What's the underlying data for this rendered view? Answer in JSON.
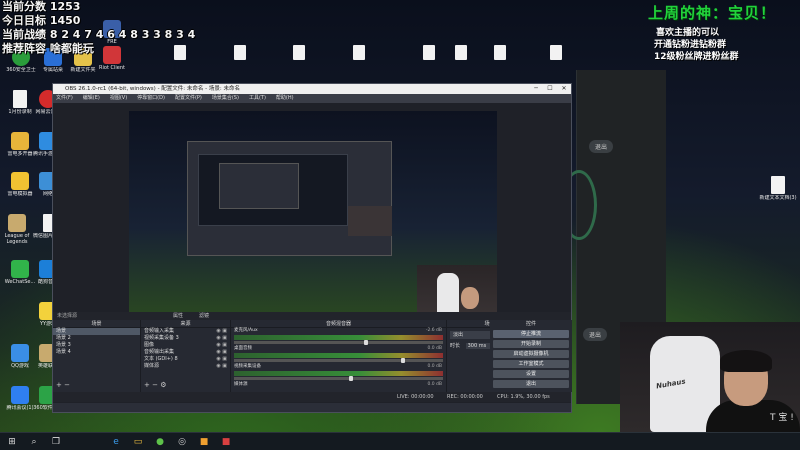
{
  "overlay": {
    "score_line": "当前分数 1253",
    "target_line": "今日目标 1450",
    "record_line": "当前战绩 8 2 4 7 4 6 4 8 3 3 8 3 4",
    "recommend_line": "推荐阵容 啥都能玩"
  },
  "right_overlay": {
    "title": "上周的神：宝贝！",
    "line1": "喜欢主播的可以",
    "line2": "开通钻粉进钻粉群",
    "line3": "12级粉丝牌进粉丝群"
  },
  "desktop_icons": [
    {
      "label": "360安全卫士",
      "color": "#2a9d3b"
    },
    {
      "label": "专属站桌",
      "color": "#2a6fd6"
    },
    {
      "label": "新建文件夹",
      "color": "#e4c24a"
    },
    {
      "label": "FRE",
      "color": "#3a5fa8"
    },
    {
      "label": "Riot Client",
      "color": "#d13639"
    },
    {
      "label": "1月份录制",
      "color": "#f0f0f0"
    },
    {
      "label": "网易云音乐",
      "color": "#d42b2b"
    },
    {
      "label": "雷电多开器",
      "color": "#e7b43a"
    },
    {
      "label": "腾讯手游助手",
      "color": "#2f8ce0"
    },
    {
      "label": "雷电模拟器",
      "color": "#f1c232"
    },
    {
      "label": "网络",
      "color": "#3d8fd6"
    },
    {
      "label": "League of Legends",
      "color": "#c8aa6e"
    },
    {
      "label": "微信图片_2022053...",
      "color": "#f0f0f0"
    },
    {
      "label": "WeChatSe...",
      "color": "#31b34a"
    },
    {
      "label": "酷狗音乐",
      "color": "#1c7fd8"
    },
    {
      "label": "YY游戏",
      "color": "#f3d23c"
    },
    {
      "label": "QQ游戏",
      "color": "#3a8ee6"
    },
    {
      "label": "英雄联盟",
      "color": "#c8aa6e"
    },
    {
      "label": "腾讯会议(1)",
      "color": "#2f7ff0"
    },
    {
      "label": "360软件管家",
      "color": "#2ca347"
    }
  ],
  "right_doc_icon": {
    "label": "新建文本文档(3)"
  },
  "obs": {
    "title": "OBS 26.1.0-rc1 (64-bit, windows) - 配置文件: 未命名 - 场景: 未命名",
    "menu": [
      "文件(F)",
      "编辑(E)",
      "视图(V)",
      "停靠窗口(D)",
      "配置文件(P)",
      "场景集合(S)",
      "工具(T)",
      "帮助(H)"
    ],
    "window_controls": [
      "─",
      "☐",
      "✕"
    ],
    "no_source": "未选择源",
    "tabs": [
      "属性",
      "滤镜"
    ],
    "docks": {
      "scenes": "场景",
      "sources": "来源",
      "mixer": "音频混音器",
      "transitions": "场景过渡",
      "controls": "控件"
    },
    "scenes": [
      "场景",
      "场景 2",
      "场景 3",
      "场景 4"
    ],
    "sources": [
      "音频输入采集",
      "视频采集设备 3",
      "图像",
      "音频输出采集",
      "文本 (GDI+) 8",
      "媒体源"
    ],
    "mixer": [
      {
        "name": "麦克风/Aux",
        "db": "-2.6 dB",
        "level": 0.62
      },
      {
        "name": "桌面音频",
        "db": "0.0 dB",
        "level": 0.8
      },
      {
        "name": "视频采集设备",
        "db": "0.0 dB",
        "level": 0.55
      },
      {
        "name": "媒体源",
        "db": "0.0 dB",
        "level": 0.5
      }
    ],
    "transition": {
      "type": "淡出",
      "duration_label": "时长",
      "duration": "300 ms"
    },
    "controls": [
      "停止推流",
      "开始录制",
      "启动虚拟摄像机",
      "工作室模式",
      "设置",
      "退出"
    ],
    "status": {
      "live": "LIVE: 00:00:00",
      "rec": "REC: 00:00:00",
      "cpu": "CPU: 1.9%, 30.00 fps"
    }
  },
  "bgapp": {
    "exit_label": "退出",
    "settings_label": "退出"
  },
  "webcam": {
    "chair_brand": "Nuhaus",
    "shirt_text": "T 宝 !"
  },
  "taskbar": {
    "items": [
      {
        "name": "start",
        "glyph": "⊞"
      },
      {
        "name": "search",
        "glyph": "⌕"
      },
      {
        "name": "task-view",
        "glyph": "❐"
      },
      {
        "name": "edge",
        "glyph": "e"
      },
      {
        "name": "folder",
        "glyph": "▭"
      },
      {
        "name": "app-green",
        "glyph": "●"
      },
      {
        "name": "app-dark",
        "glyph": "◎"
      },
      {
        "name": "app-orange",
        "glyph": "■"
      },
      {
        "name": "app-red",
        "glyph": "■"
      }
    ]
  }
}
